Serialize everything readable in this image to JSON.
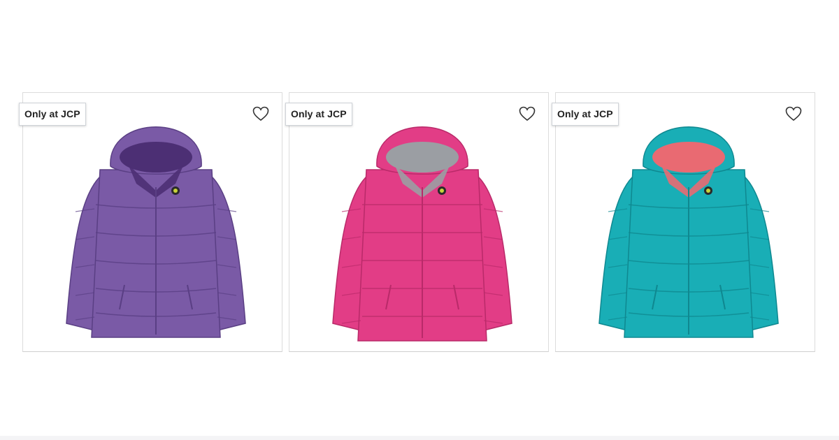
{
  "products": [
    {
      "badge": "Only at JCP",
      "icon": "heart-outline-icon",
      "colors": {
        "body": "#7a5aa6",
        "dark": "#5a3f84",
        "lining": "#4c2f74",
        "trim": "#6b4c98"
      }
    },
    {
      "badge": "Only at JCP",
      "icon": "heart-outline-icon",
      "colors": {
        "body": "#e23d86",
        "dark": "#b92a69",
        "lining": "#9b9ea3",
        "trim": "#cf2f77"
      }
    },
    {
      "badge": "Only at JCP",
      "icon": "heart-outline-icon",
      "colors": {
        "body": "#19aeb6",
        "dark": "#0f8890",
        "lining": "#e96a72",
        "trim": "#1497a0"
      }
    }
  ]
}
